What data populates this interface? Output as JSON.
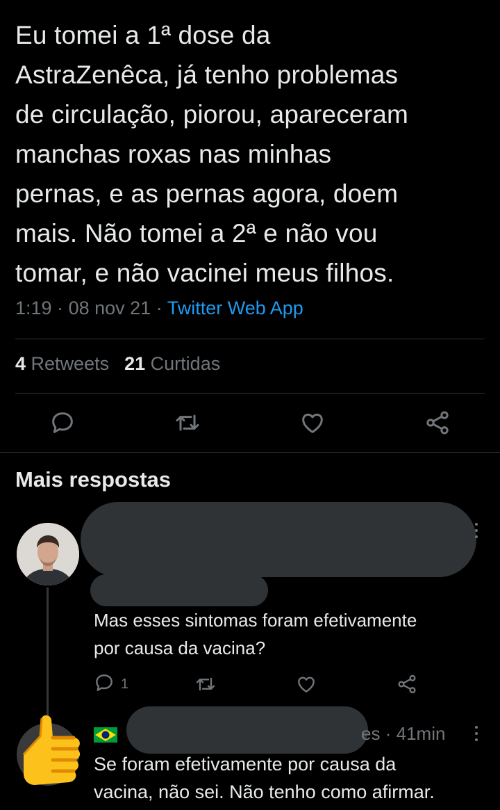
{
  "tweet": {
    "text": "Eu tomei a 1ª dose da\nAstraZenêca, já tenho problemas\nde circulação, piorou, apareceram\nmanchas roxas nas minhas\npernas, e as pernas agora, doem\nmais. Não tomei a 2ª e não vou\ntomar, e não vacinei meus filhos.",
    "time": "1:19",
    "date": "08 nov 21",
    "separator": "·",
    "app": "Twitter Web App"
  },
  "stats": {
    "retweets_count": "4",
    "retweets_label": "Retweets",
    "likes_count": "21",
    "likes_label": "Curtidas"
  },
  "actions": {
    "icons": [
      "reply-icon",
      "retweet-icon",
      "like-icon",
      "share-icon"
    ]
  },
  "more_replies": {
    "title": "Mais respostas"
  },
  "replies": [
    {
      "text": "Mas esses sintomas foram efetivamente\npor causa da vacina?",
      "reply_count": "1"
    },
    {
      "handle_tail": "es",
      "time": "41min",
      "separator": "·",
      "text": "Se foram efetivamente por causa da\nvacina, não sei. Não tenho como afirmar."
    }
  ],
  "colors": {
    "background": "#000000",
    "text": "#e7e9ea",
    "muted": "#71767b",
    "accent": "#1d9bf0",
    "divider": "#2f3336",
    "redaction": "#2f3336"
  }
}
